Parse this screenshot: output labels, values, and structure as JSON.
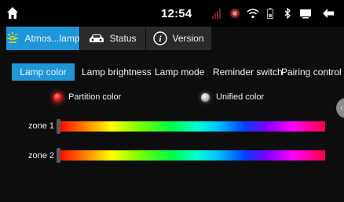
{
  "status_bar": {
    "time": "12:54",
    "icons": [
      "home-icon",
      "signal-icon",
      "no-sim-icon",
      "wifi-icon",
      "battery-icon",
      "bluetooth-icon",
      "screen-icon",
      "back-icon"
    ]
  },
  "top_tabs": [
    {
      "label": "Atmos...lamp",
      "icon": "ambient-light-icon",
      "active": true
    },
    {
      "label": "Status",
      "icon": "car-icon",
      "active": false
    },
    {
      "label": "Version",
      "icon": "info-icon",
      "active": false
    }
  ],
  "sub_tabs": [
    {
      "label": "Lamp color",
      "active": true
    },
    {
      "label": "Lamp brightness",
      "active": false
    },
    {
      "label": "Lamp mode",
      "active": false
    },
    {
      "label": "Reminder switch",
      "active": false
    },
    {
      "label": "Pairing control",
      "active": false
    }
  ],
  "color_mode": {
    "options": [
      {
        "label": "Partition color",
        "selected": true
      },
      {
        "label": "Unified color",
        "selected": false
      }
    ]
  },
  "zones": [
    {
      "label": "zone 1",
      "value_fraction": 0.0
    },
    {
      "label": "zone 2",
      "value_fraction": 0.0
    }
  ],
  "colors": {
    "accent": "#1e96d8",
    "background": "#0d0d0d",
    "tab_bg": "#2a2a2a",
    "selected_dot": "#ee2020"
  }
}
